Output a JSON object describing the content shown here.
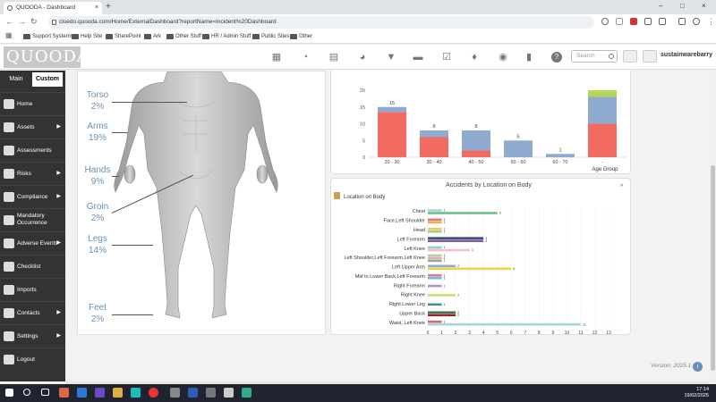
{
  "browser": {
    "tab_title": "QUOODA - Dashboard",
    "url": "cluedo.quooda.com/Home/ExternalDashboard?reportName=Incident%20Dashboard",
    "bookmarks": [
      "Support Systems",
      "Help Site",
      "SharePoint",
      "Ark",
      "Other Stuff",
      "HR / Admin Stuff",
      "Public Sites",
      "Other"
    ]
  },
  "header": {
    "logo": "QUOODA",
    "icons": [
      "calendar-icon",
      "gauge-icon",
      "inbox-icon",
      "pie-chart-icon",
      "filter-icon",
      "folder-icon",
      "checklist-icon",
      "bell-icon",
      "eye-icon",
      "bookmark-icon",
      "help-icon"
    ],
    "search_placeholder": "Search",
    "username": "sustainwarebarry"
  },
  "sidebar": {
    "tabs": [
      "Main",
      "Custom"
    ],
    "items": [
      {
        "label": "Home",
        "icon": "home-icon",
        "arrow": false
      },
      {
        "label": "Assets",
        "icon": "assets-icon",
        "arrow": true
      },
      {
        "label": "Assessments",
        "icon": "assessments-icon",
        "arrow": false
      },
      {
        "label": "Risks",
        "icon": "risks-icon",
        "arrow": true
      },
      {
        "label": "Compliance",
        "icon": "compliance-icon",
        "arrow": true
      },
      {
        "label": "Mandatory Occurrence",
        "icon": "mandatory-icon",
        "arrow": false
      },
      {
        "label": "Adverse Events",
        "icon": "adverse-events-icon",
        "arrow": true
      },
      {
        "label": "Checklist",
        "icon": "checklist-icon",
        "arrow": false
      },
      {
        "label": "Imports",
        "icon": "imports-icon",
        "arrow": false
      },
      {
        "label": "Contacts",
        "icon": "contacts-icon",
        "arrow": true
      },
      {
        "label": "Settings",
        "icon": "settings-icon",
        "arrow": true
      },
      {
        "label": "Logout",
        "icon": "logout-icon",
        "arrow": false
      }
    ]
  },
  "body_map": {
    "parts": [
      {
        "name": "Torso",
        "pct": "2%"
      },
      {
        "name": "Arms",
        "pct": "19%"
      },
      {
        "name": "Hands",
        "pct": "9%"
      },
      {
        "name": "Groin",
        "pct": "2%"
      },
      {
        "name": "Legs",
        "pct": "14%"
      },
      {
        "name": "Feet",
        "pct": "2%"
      }
    ]
  },
  "chart_data": [
    {
      "type": "bar",
      "stacked": true,
      "title": "",
      "xlabel": "Age Group",
      "categories": [
        "20 - 30",
        "30 - 40",
        "40 - 50",
        "50 - 60",
        "60 - 70",
        "-"
      ],
      "totals": [
        15,
        8,
        8,
        5,
        1,
        null
      ],
      "series": [
        {
          "name": "",
          "color": "#f26b61",
          "values": [
            13.5,
            6,
            2,
            0,
            0,
            10
          ]
        },
        {
          "name": "",
          "color": "#8fabd0",
          "values": [
            1.5,
            2,
            6,
            5,
            1,
            8
          ]
        },
        {
          "name": "",
          "color": "#b7d65a",
          "values": [
            0,
            0,
            0,
            0,
            0,
            2
          ]
        }
      ],
      "ylim": [
        0,
        20
      ],
      "yticks": [
        0,
        5,
        10,
        15,
        20
      ],
      "grid": false
    },
    {
      "type": "bar",
      "orientation": "horizontal",
      "title": "Accidents by Location on Body",
      "subtitle": "Location on Body",
      "categories": [
        "Chest",
        "Face,Left Shoulder",
        "Head",
        "Left Forearm",
        "Left Knee",
        "Left Shoulder,Left Forearm,Left Knee",
        "Left Upper Arm",
        "Mid to Lower Back,Left Forearm",
        "Right Forearm",
        "Right Knee",
        "Right Lower Leg",
        "Upper Back",
        "Waist, Left Knee"
      ],
      "bars": [
        {
          "category": "Chest",
          "value": 1,
          "color": "#a9d3dc"
        },
        {
          "category": "Chest",
          "value": 5,
          "color": "#6cc08b"
        },
        {
          "category": "Face,Left Shoulder",
          "value": 1,
          "color": "#e07a74"
        },
        {
          "category": "Face,Left Shoulder",
          "value": 1,
          "color": "#f0a95a"
        },
        {
          "category": "Head",
          "value": 1,
          "color": "#f3c75e"
        },
        {
          "category": "Head",
          "value": 1,
          "color": "#9ccf8a"
        },
        {
          "category": "Left Forearm",
          "value": 4,
          "color": "#3c4e80"
        },
        {
          "category": "Left Forearm",
          "value": 4,
          "color": "#7c5aa0"
        },
        {
          "category": "Left Knee",
          "value": 1,
          "color": "#8fd0c4"
        },
        {
          "category": "Left Knee",
          "value": 3,
          "color": "#f1c0c8"
        },
        {
          "category": "Left Shoulder,Left Forearm,Left Knee",
          "value": 1,
          "color": "#b8cfa0"
        },
        {
          "category": "Left Shoulder,Left Forearm,Left Knee",
          "value": 1,
          "color": "#e0b0a0"
        },
        {
          "category": "Left Shoulder,Left Forearm,Left Knee",
          "value": 1,
          "color": "#a0a0a0"
        },
        {
          "category": "Left Upper Arm",
          "value": 2,
          "color": "#8fabd0"
        },
        {
          "category": "Left Upper Arm",
          "value": 6,
          "color": "#f3d04a"
        },
        {
          "category": "Mid to Lower Back,Left Forearm",
          "value": 1,
          "color": "#d08090"
        },
        {
          "category": "Mid to Lower Back,Left Forearm",
          "value": 1,
          "color": "#7fb5e0"
        },
        {
          "category": "Right Forearm",
          "value": 1,
          "color": "#b090d0"
        },
        {
          "category": "Right Knee",
          "value": 2,
          "color": "#c8e06a"
        },
        {
          "category": "Right Lower Leg",
          "value": 1,
          "color": "#4a8a90"
        },
        {
          "category": "Upper Back",
          "value": 2,
          "color": "#3a7a5a"
        },
        {
          "category": "Upper Back",
          "value": 2,
          "color": "#a02020"
        },
        {
          "category": "Waist, Left Knee",
          "value": 1,
          "color": "#d06a6a"
        },
        {
          "category": "Waist, Left Knee",
          "value": 11,
          "color": "#a9d3dc"
        }
      ],
      "xlim": [
        0,
        13
      ],
      "xticks": [
        0,
        1,
        2,
        3,
        4,
        5,
        6,
        7,
        8,
        9,
        10,
        11,
        12,
        13
      ],
      "grid": true
    }
  ],
  "footer": {
    "version": "Version: 2025.1"
  },
  "taskbar": {
    "time": "17:14",
    "date": "19/02/2025"
  }
}
